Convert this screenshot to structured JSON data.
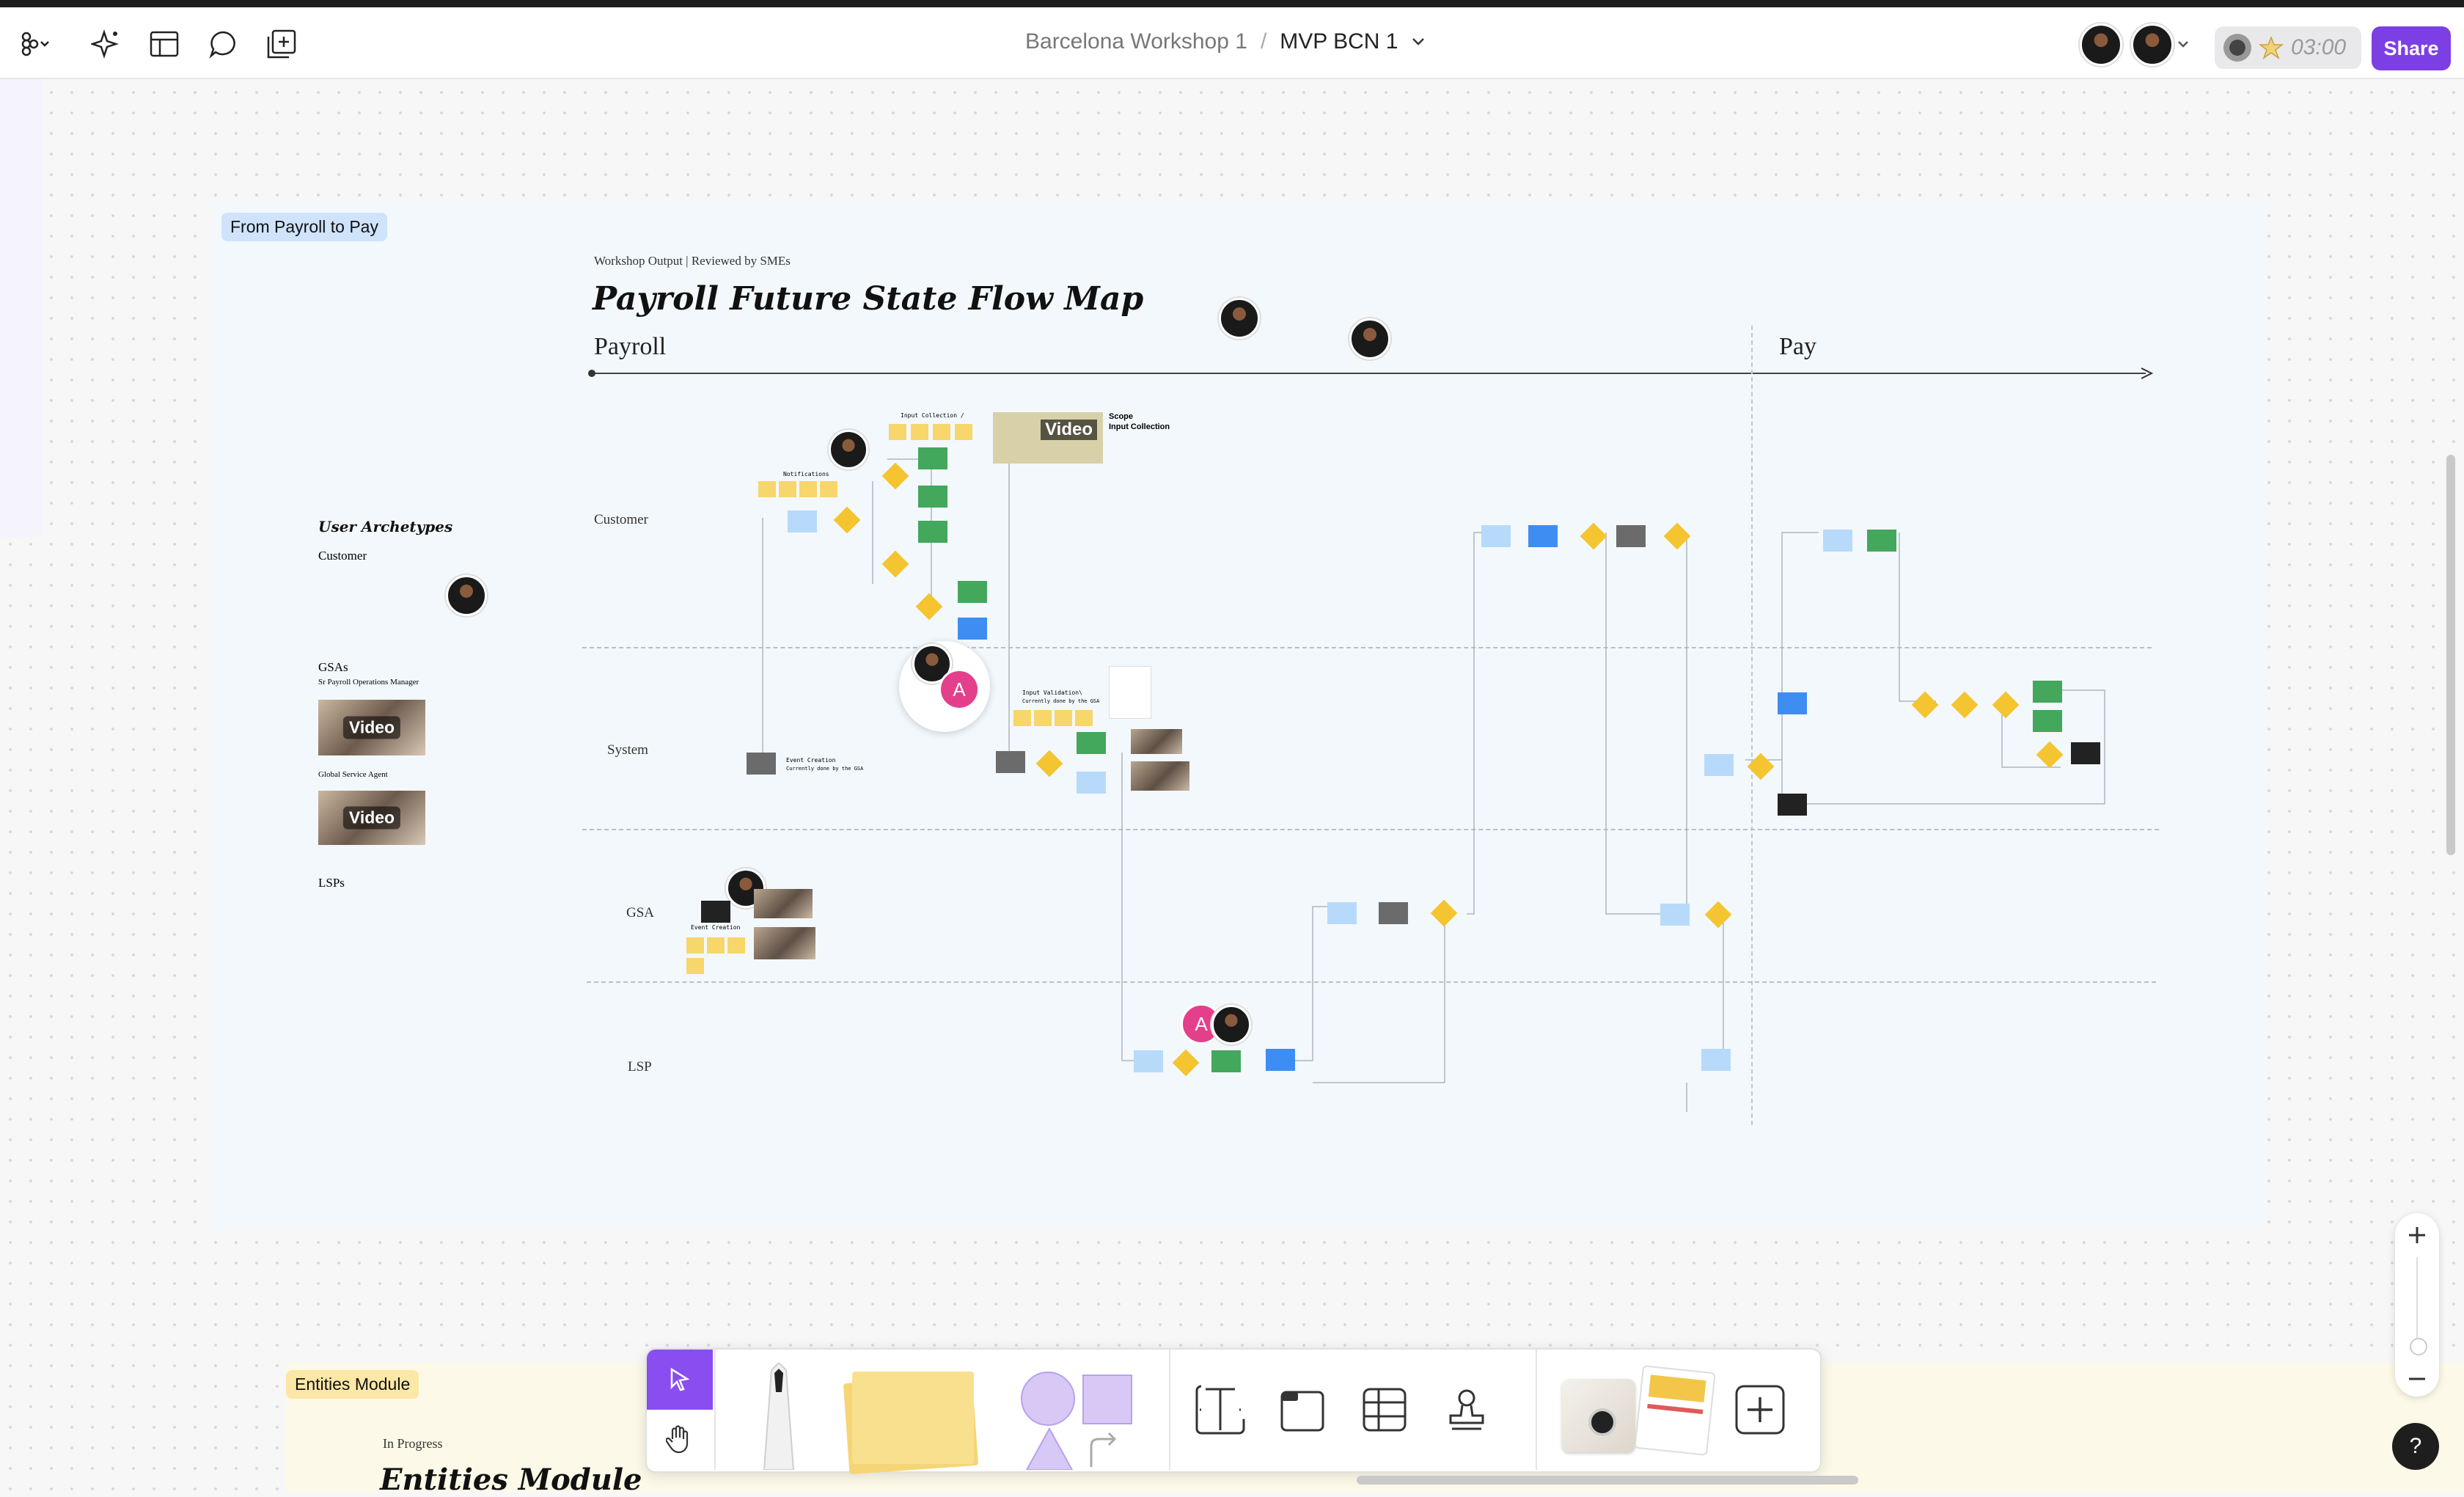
{
  "header": {
    "project": "Barcelona Workshop 1",
    "separator": "/",
    "file": "MVP BCN 1",
    "timer": "03:00",
    "share_label": "Share"
  },
  "section": {
    "label": "From Payroll to Pay",
    "subtitle": "Workshop Output | Reviewed by SMEs",
    "title": "Payroll Future State Flow Map",
    "phase_left": "Payroll",
    "phase_right": "Pay"
  },
  "archetypes": {
    "heading": "User Archetypes",
    "customer": "Customer",
    "gsas": "GSAs",
    "sr_manager": "Sr Payroll Operations Manager",
    "global_agent": "Global Service Agent",
    "lsps": "LSPs",
    "video_label": "Video"
  },
  "lanes": {
    "customer": "Customer",
    "system": "System",
    "gsa": "GSA",
    "lsp": "LSP"
  },
  "flow_notes": {
    "notifications": "Notifications",
    "input_collection": "Input Collection /",
    "scope": "Scope",
    "scope_sub": "Input Collection",
    "input_validation": "Input Validation\\",
    "validation_note": "Currently done by the GSA",
    "event_creation": "Event Creation",
    "event_note": "Currently done by the GSA",
    "event_creation_gsa": "Event Creation"
  },
  "avatar_initial": "A",
  "bottom": {
    "label": "Entities Module",
    "status": "In Progress",
    "title": "Entities Module"
  },
  "help_label": "?",
  "colors": {
    "accent": "#7b3fe4",
    "sticky": "#f7d66b",
    "process": "#43a75c",
    "system": "#3e8df2",
    "decision": "#f4c531",
    "section_label_bg": "#cfe3fb",
    "entities_label_bg": "#fbe7a6"
  }
}
